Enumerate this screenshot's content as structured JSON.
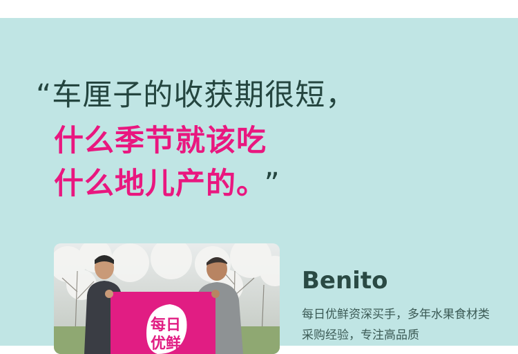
{
  "quote": {
    "open_mark": "“",
    "line1": "车厘子的收获期很短，",
    "line2": "什么季节就该吃",
    "line3": "什么地儿产的。",
    "close_mark": "”"
  },
  "person": {
    "name": "Benito",
    "bio": "每日优鲜资深买手，多年水果食材类采购经验，专注高品质"
  },
  "photo": {
    "banner_text_line1": "每日",
    "banner_text_line2": "优鲜"
  },
  "colors": {
    "background": "#c0e5e4",
    "heading_dark": "#24453f",
    "accent_pink": "#e9177f"
  }
}
